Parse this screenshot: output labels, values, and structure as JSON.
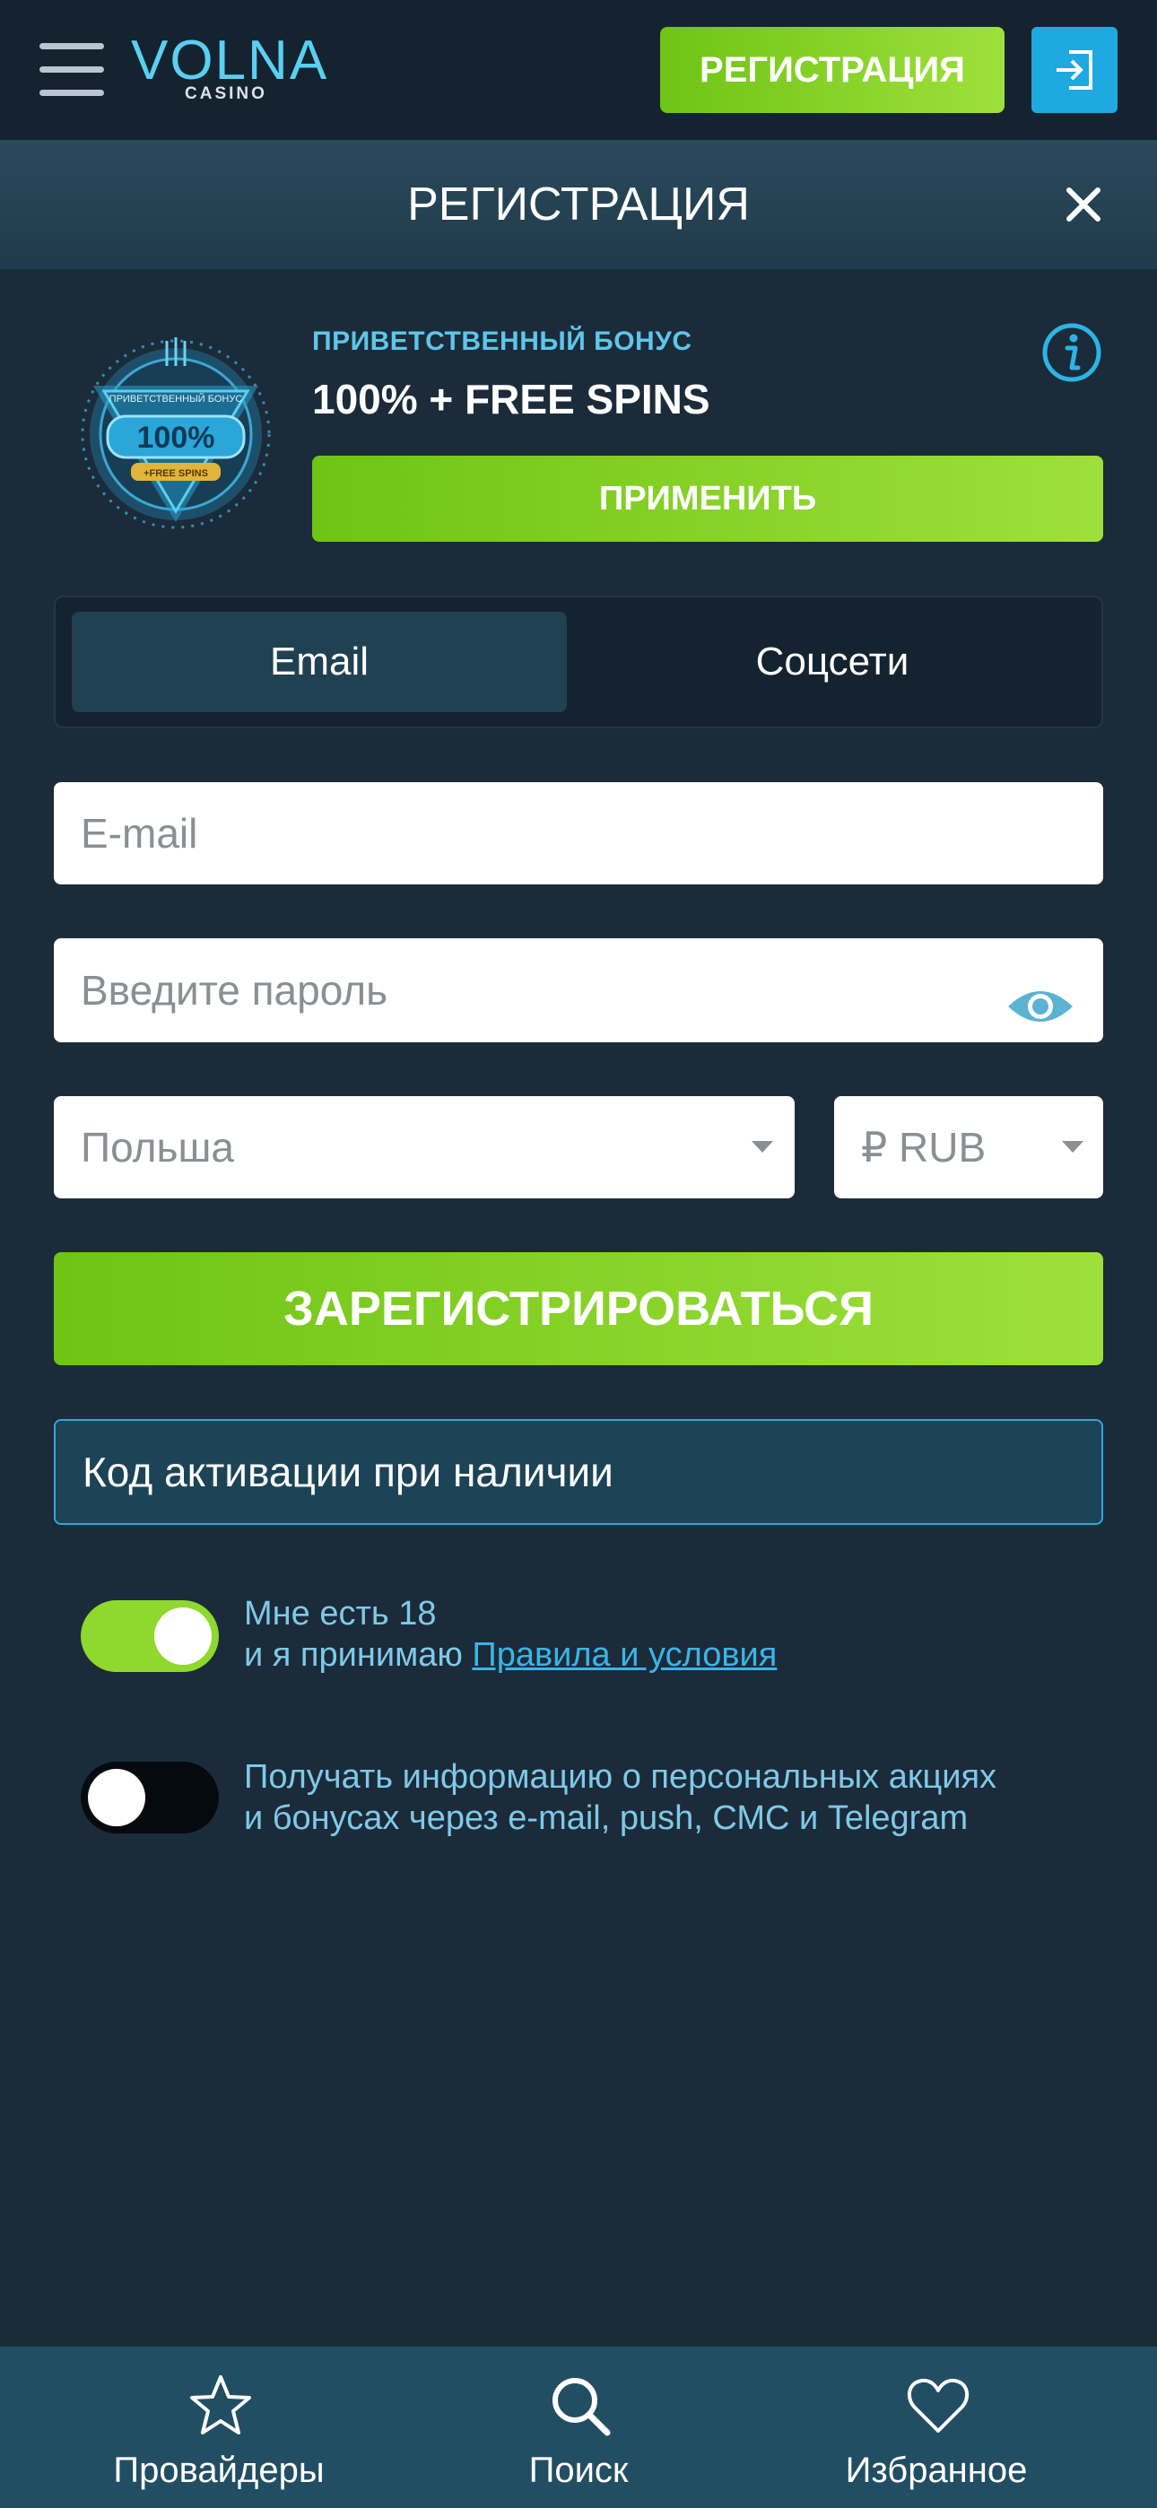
{
  "header": {
    "logo_text": "VOLNA",
    "logo_sub": "CASINO",
    "register_label": "РЕГИСТРАЦИЯ"
  },
  "modal": {
    "title": "РЕГИСТРАЦИЯ"
  },
  "bonus": {
    "label": "ПРИВЕТСТВЕННЫЙ БОНУС",
    "title": "100% + FREE SPINS",
    "apply_label": "ПРИМЕНИТЬ",
    "badge_top": "ПРИВЕТСТВЕННЫЙ БОНУС",
    "badge_value": "100%",
    "badge_bottom": "+FREE SPINS"
  },
  "tabs": [
    {
      "label": "Email",
      "active": true
    },
    {
      "label": "Соцсети",
      "active": false
    }
  ],
  "form": {
    "email_placeholder": "E-mail",
    "password_placeholder": "Введите пароль",
    "country": "Польша",
    "currency": "₽ RUB",
    "submit_label": "ЗАРЕГИСТРИРОВАТЬСЯ",
    "promo_label": "Код активации при наличии"
  },
  "consents": {
    "age": {
      "line1": "Мне есть 18",
      "line2_prefix": "и я принимаю ",
      "link": "Правила и условия",
      "checked": true
    },
    "marketing": {
      "line1": "Получать информацию о персональных акциях",
      "line2": "и бонусах через e-mail, push, СМС и Telegram",
      "checked": false
    }
  },
  "bottom_nav": [
    {
      "label": "Провайдеры",
      "icon": "star-icon"
    },
    {
      "label": "Поиск",
      "icon": "search-icon"
    },
    {
      "label": "Избранное",
      "icon": "heart-icon"
    }
  ],
  "colors": {
    "accent_green": "#8fd82e",
    "accent_blue": "#1ea9e0",
    "background": "#1b2b39"
  }
}
